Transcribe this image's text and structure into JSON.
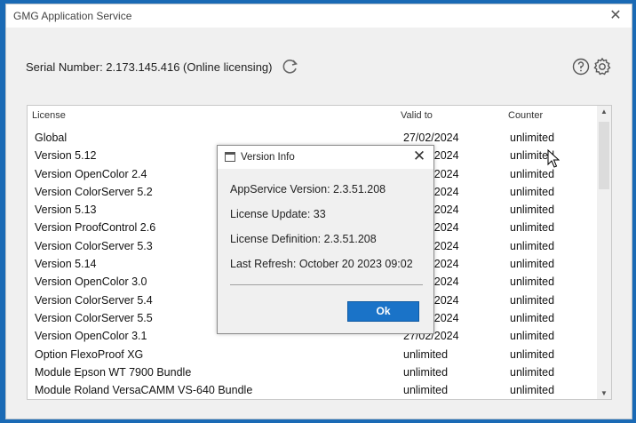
{
  "window": {
    "title": "GMG Application Service",
    "close_symbol": "✕"
  },
  "serial": {
    "text": "Serial Number: 2.173.145.416 (Online licensing)"
  },
  "table": {
    "headers": [
      "License",
      "Valid to",
      "Counter"
    ],
    "rows": [
      [
        "Global",
        "27/02/2024",
        "unlimited"
      ],
      [
        "Version 5.12",
        "27/02/2024",
        "unlimited"
      ],
      [
        "Version OpenColor 2.4",
        "27/02/2024",
        "unlimited"
      ],
      [
        "Version ColorServer 5.2",
        "27/02/2024",
        "unlimited"
      ],
      [
        "Version 5.13",
        "27/02/2024",
        "unlimited"
      ],
      [
        "Version ProofControl 2.6",
        "27/02/2024",
        "unlimited"
      ],
      [
        "Version ColorServer 5.3",
        "27/02/2024",
        "unlimited"
      ],
      [
        "Version 5.14",
        "27/02/2024",
        "unlimited"
      ],
      [
        "Version OpenColor 3.0",
        "27/02/2024",
        "unlimited"
      ],
      [
        "Version ColorServer 5.4",
        "27/02/2024",
        "unlimited"
      ],
      [
        "Version ColorServer 5.5",
        "27/02/2024",
        "unlimited"
      ],
      [
        "Version OpenColor 3.1",
        "27/02/2024",
        "unlimited"
      ],
      [
        "Option FlexoProof XG",
        "unlimited",
        "unlimited"
      ],
      [
        "Module Epson WT 7900 Bundle",
        "unlimited",
        "unlimited"
      ],
      [
        "Module Roland VersaCAMM VS-640 Bundle",
        "unlimited",
        "unlimited"
      ]
    ]
  },
  "dialog": {
    "title": "Version Info",
    "close_symbol": "✕",
    "lines": [
      "AppService Version: 2.3.51.208",
      "License Update: 33",
      "License Definition: 2.3.51.208",
      "Last Refresh: October 20 2023 09:02"
    ],
    "ok_label": "Ok"
  },
  "icons": {
    "refresh": "refresh-icon",
    "help": "help-icon",
    "settings": "gear-icon"
  },
  "colors": {
    "accent": "#1a73c8",
    "desktop": "#1a6ab5"
  }
}
